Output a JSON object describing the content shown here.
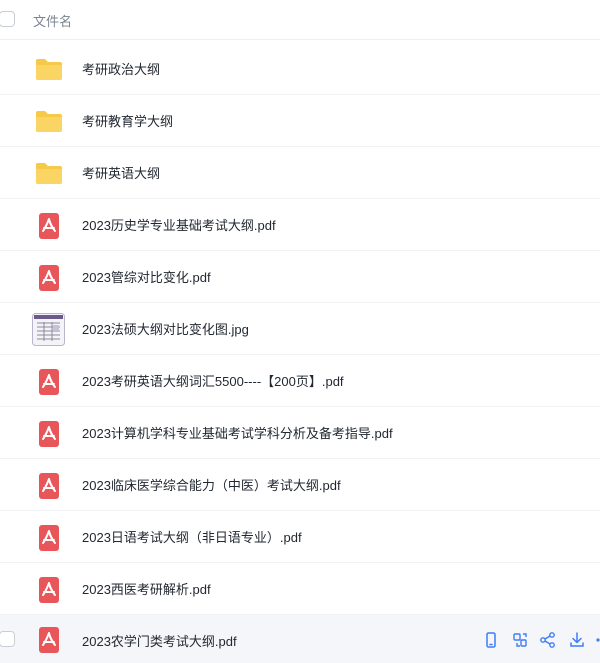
{
  "header": {
    "column_label": "文件名"
  },
  "files": [
    {
      "name": "考研政治大纲",
      "type": "folder"
    },
    {
      "name": "考研教育学大纲",
      "type": "folder"
    },
    {
      "name": "考研英语大纲",
      "type": "folder"
    },
    {
      "name": "2023历史学专业基础考试大纲.pdf",
      "type": "pdf"
    },
    {
      "name": "2023管综对比变化.pdf",
      "type": "pdf"
    },
    {
      "name": "2023法硕大纲对比变化图.jpg",
      "type": "image"
    },
    {
      "name": "2023考研英语大纲词汇5500----【200页】.pdf",
      "type": "pdf"
    },
    {
      "name": "2023计算机学科专业基础考试学科分析及备考指导.pdf",
      "type": "pdf"
    },
    {
      "name": "2023临床医学综合能力（中医）考试大纲.pdf",
      "type": "pdf"
    },
    {
      "name": "2023日语考试大纲（非日语专业）.pdf",
      "type": "pdf"
    },
    {
      "name": "2023西医考研解析.pdf",
      "type": "pdf"
    },
    {
      "name": "2023农学门类考试大纲.pdf",
      "type": "pdf"
    }
  ],
  "row_actions": [
    "phone-icon",
    "copy-icon",
    "share-icon",
    "download-icon"
  ],
  "colors": {
    "folder": "#f7c948",
    "pdf": "#e8565a",
    "action": "#3d7df7",
    "hover_row": "#f5f6fa"
  }
}
